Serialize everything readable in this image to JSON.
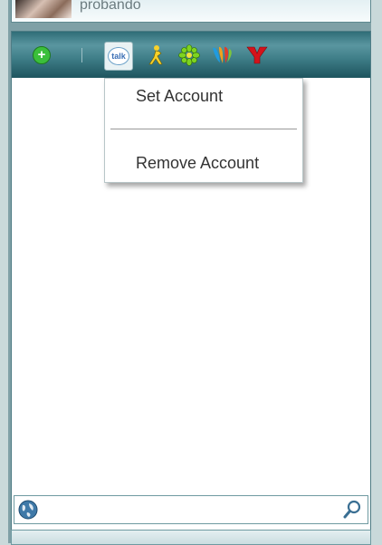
{
  "profile": {
    "username": "probando"
  },
  "toolbar": {
    "add_label": "+",
    "talk_label": "talk",
    "icons": [
      "add-contact-icon",
      "google-talk-icon",
      "aim-icon",
      "icq-icon",
      "msn-icon",
      "yahoo-icon"
    ]
  },
  "menu": {
    "items": [
      {
        "label": "Set Account"
      },
      {
        "label": "Remove Account"
      }
    ]
  },
  "search": {
    "value": "",
    "placeholder": ""
  },
  "colors": {
    "toolbar": "#3e7d87",
    "frame": "#7fa0a6",
    "accent": "#3bbf3b"
  }
}
